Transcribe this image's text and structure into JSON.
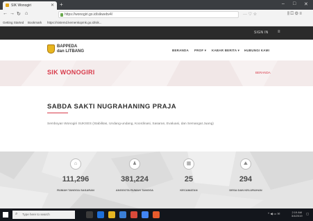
{
  "browser": {
    "tab_title": "SIK Wonogiri",
    "url": "https://wonogiri.go.id/sikwebv4/",
    "bookmarks": [
      "Getting Started",
      "Bookmark",
      "https://sistemd.kemenkopmk.go.id/sik..."
    ]
  },
  "site": {
    "signin": "SIGN IN",
    "brand_line1": "BAPPEDA",
    "brand_line2": "dan LITBANG",
    "nav": [
      {
        "label": "BERANDA"
      },
      {
        "label": "PROF ▾"
      },
      {
        "label": "KABAR BERITA ▾"
      },
      {
        "label": "HUBUNGI KAMI"
      }
    ],
    "hero_title": "SIK WONOGIRI",
    "hero_link": "BERANDA",
    "main_title": "SABDA SAKTI NUGRAHANING PRAJA",
    "tagline": "Semboyan Wonogiri SUKSES (Stabilitas, Undang-undang, Koordinasi, Sasaran, Evaluasi, dan Semangat Juang)"
  },
  "stats": [
    {
      "icon": "home-icon",
      "glyph": "⌂",
      "value": "111,296",
      "label": "RUMAH TANGGA SASARAN"
    },
    {
      "icon": "people-icon",
      "glyph": "♟",
      "value": "381,224",
      "label": "ANGGOTA RUMAH TANGGA"
    },
    {
      "icon": "building-icon",
      "glyph": "▦",
      "value": "25",
      "label": "KECAMATAN"
    },
    {
      "icon": "map-icon",
      "glyph": "⛰",
      "value": "294",
      "label": "DESA DAN KELURAHAN"
    }
  ],
  "taskbar": {
    "search_placeholder": "Type here to search",
    "time": "2:19 AM",
    "date": "3/4/2019"
  },
  "colors": {
    "accent": "#d83a4a",
    "topstrip": "#2b2b2b",
    "taskbar": "#13161c"
  }
}
